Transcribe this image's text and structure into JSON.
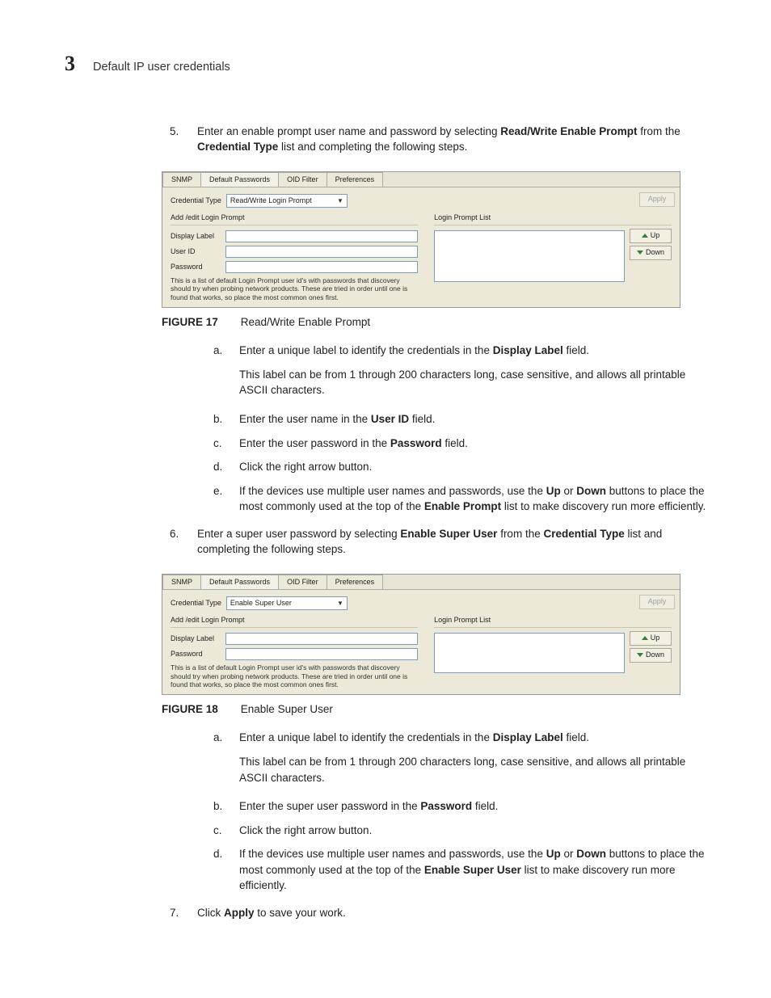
{
  "header": {
    "chapter_number": "3",
    "chapter_title": "Default IP user credentials"
  },
  "step5": {
    "num": "5.",
    "text_before": "Enter an enable prompt user name and password by selecting ",
    "bold1": "Read/Write Enable Prompt",
    "text_mid": " from the ",
    "bold2": "Credential Type",
    "text_after": " list and completing the following steps."
  },
  "figure17": {
    "caption_label": "FIGURE 17",
    "caption_text": "Read/Write Enable Prompt",
    "tabs": [
      "SNMP",
      "Default Passwords",
      "OID Filter",
      "Preferences"
    ],
    "credential_type_label": "Credential Type",
    "credential_type_value": "Read/Write Login Prompt",
    "section_left": "Add /edit Login Prompt",
    "section_right": "Login Prompt List",
    "display_label": "Display Label",
    "user_id": "User ID",
    "password": "Password",
    "help": "This is a list of default Login Prompt user id's with passwords that discovery should try when probing network products. These are tried in order until one is found that works, so place the most common ones first.",
    "up": "Up",
    "down": "Down",
    "apply": "Apply"
  },
  "step5_sub": {
    "a": {
      "letter": "a.",
      "before": "Enter a unique label to identify the credentials in the ",
      "bold": "Display Label",
      "after": " field.",
      "note": "This label can be from 1 through 200 characters long, case sensitive, and allows all printable ASCII characters."
    },
    "b": {
      "letter": "b.",
      "before": "Enter the user name in the ",
      "bold": "User ID",
      "after": " field."
    },
    "c": {
      "letter": "c.",
      "before": "Enter the user password in the ",
      "bold": "Password",
      "after": " field."
    },
    "d": {
      "letter": "d.",
      "text": "Click the right arrow button."
    },
    "e": {
      "letter": "e.",
      "before": "If the devices use multiple user names and passwords, use the ",
      "bold1": "Up",
      "mid1": " or ",
      "bold2": "Down",
      "mid2": " buttons to place the most commonly used at the top of the ",
      "bold3": "Enable Prompt",
      "after": " list to make discovery run more efficiently."
    }
  },
  "step6": {
    "num": "6.",
    "before": "Enter a super user password by selecting ",
    "bold1": "Enable Super User",
    "mid": " from the ",
    "bold2": "Credential Type",
    "after": " list and completing the following steps."
  },
  "figure18": {
    "caption_label": "FIGURE 18",
    "caption_text": "Enable Super User",
    "tabs": [
      "SNMP",
      "Default Passwords",
      "OID Filter",
      "Preferences"
    ],
    "credential_type_label": "Credential Type",
    "credential_type_value": "Enable Super User",
    "section_left": "Add /edit Login Prompt",
    "section_right": "Login Prompt List",
    "display_label": "Display Label",
    "password": "Password",
    "help": "This is a list of default Login Prompt user id's with passwords that discovery should try when probing network products. These are tried in order until one is found that works, so place the most common ones first.",
    "up": "Up",
    "down": "Down",
    "apply": "Apply"
  },
  "step6_sub": {
    "a": {
      "letter": "a.",
      "before": "Enter a unique label to identify the credentials in the ",
      "bold": "Display Label",
      "after": " field.",
      "note": "This label can be from 1 through 200 characters long, case sensitive, and allows all printable ASCII characters."
    },
    "b": {
      "letter": "b.",
      "before": "Enter the super user password in the ",
      "bold": "Password",
      "after": " field."
    },
    "c": {
      "letter": "c.",
      "text": "Click the right arrow button."
    },
    "d": {
      "letter": "d.",
      "before": "If the devices use multiple user names and passwords, use the ",
      "bold1": "Up",
      "mid1": " or ",
      "bold2": "Down",
      "mid2": " buttons to place the most commonly used at the top of the ",
      "bold3": "Enable Super User",
      "after": " list to make discovery run more efficiently."
    }
  },
  "step7": {
    "num": "7.",
    "before": "Click ",
    "bold": "Apply",
    "after": " to save your work."
  }
}
